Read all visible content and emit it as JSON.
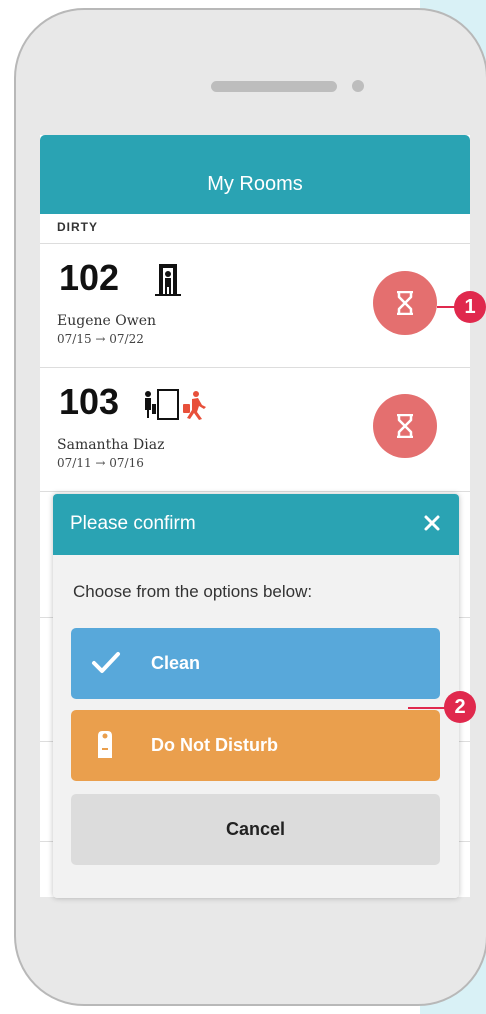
{
  "app": {
    "title": "My Rooms"
  },
  "section": {
    "label": "DIRTY"
  },
  "rooms": [
    {
      "number": "102",
      "guest": "Eugene Owen",
      "dates": "07/15 → 07/22",
      "status_icon": "hourglass-icon",
      "occupancy_icon": "door-with-person-icon"
    },
    {
      "number": "103",
      "guest": "Samantha Diaz",
      "dates": "07/11 → 07/16",
      "status_icon": "hourglass-icon",
      "occupancy_icon": "guest-leaving-door-icon"
    }
  ],
  "modal": {
    "title": "Please confirm",
    "prompt": "Choose from the options below:",
    "buttons": {
      "clean": "Clean",
      "do_not_disturb": "Do Not Disturb",
      "cancel": "Cancel"
    }
  },
  "callouts": {
    "first": "1",
    "second": "2"
  },
  "colors": {
    "header": "#2aa3b3",
    "status_button": "#e46f6f",
    "clean_button": "#58a8da",
    "dnd_button": "#ea9f4d",
    "cancel_button": "#dcdcdc",
    "callout": "#e0294d"
  }
}
